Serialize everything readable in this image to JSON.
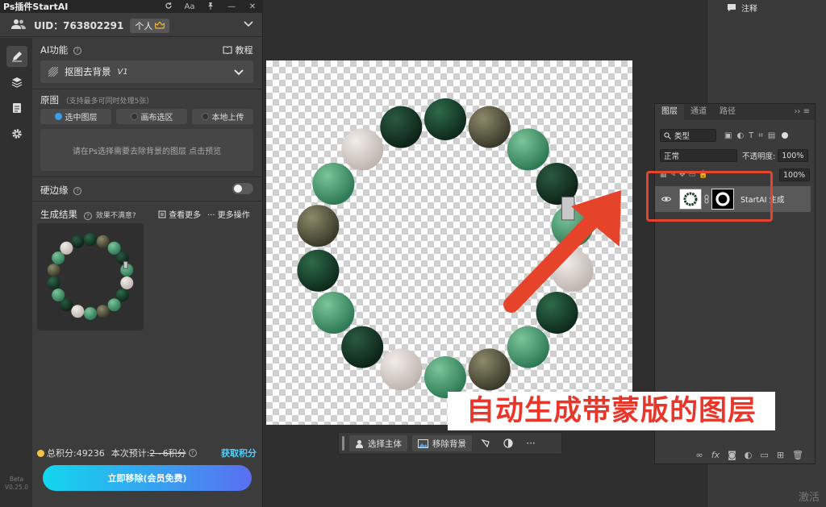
{
  "plugin": {
    "title": "Ps插件StartAI",
    "uid": "UID：763802291",
    "plan": "个人",
    "section_ai_label": "AI功能",
    "tutorial_label": "教程",
    "function_value": "抠图去背景",
    "function_version": "V1",
    "source_label": "原图",
    "source_hint": "（支持最多可同时处理5张）",
    "source_options": [
      "选中图层",
      "画布选区",
      "本地上传"
    ],
    "preview_text": "请在Ps选择需要去除背景的图层 点击预览",
    "hard_edge_label": "硬边缘",
    "result_label": "生成结果",
    "result_feedback": "效果不满意?",
    "view_more": "查看更多",
    "more_actions": "··· 更多操作",
    "credits_total": "总积分:49236",
    "credits_estimate_prefix": "本次预计:",
    "credits_estimate_value": "2~6积分",
    "get_credits": "获取积分",
    "remove_button": "立即移除(会员免费)",
    "beta": "Beta",
    "version": "V0.25.0"
  },
  "context_bar": {
    "select_subject": "选择主体",
    "remove_background": "移除背景"
  },
  "right_column": {
    "notes_label": "注释"
  },
  "layers_panel": {
    "tabs": [
      "图层",
      "通道",
      "路径"
    ],
    "filter_kind": "类型",
    "blend_mode": "正常",
    "opacity_label": "不透明度:",
    "opacity_value": "100%",
    "fill_value": "100%",
    "layer_name": "StartAI 生成"
  },
  "annotation": {
    "caption": "自动生成带蒙版的图层"
  },
  "watermark": "激活",
  "colors": {
    "accent_cyan": "#13d6ee",
    "accent_blue": "#5b6ef2",
    "annotation_red": "#e5442b",
    "credits_link": "#4fd0ff"
  }
}
